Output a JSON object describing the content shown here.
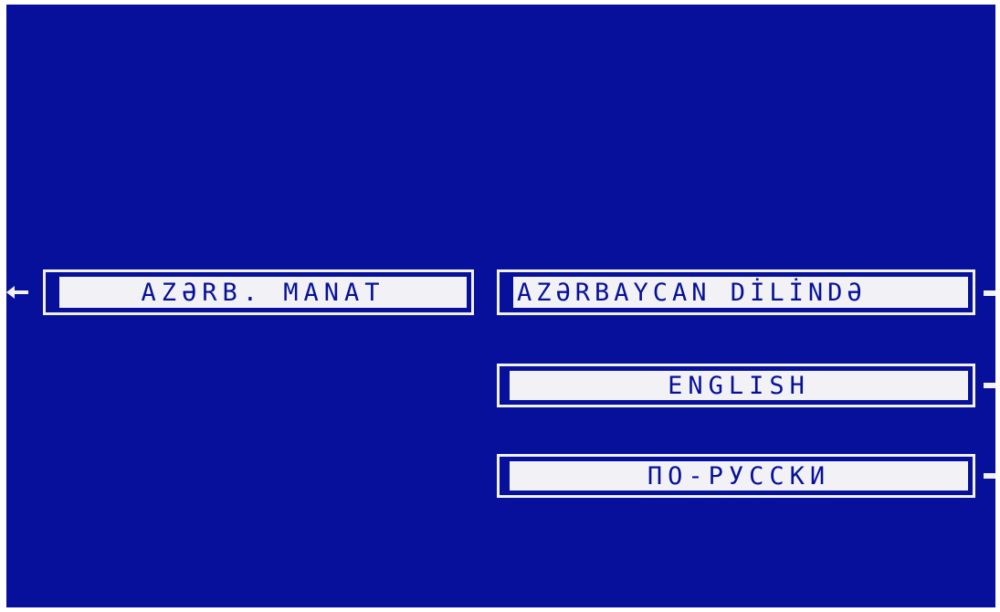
{
  "screen": {
    "background_color": "#06109a",
    "foreground_color": "#f2f2f6"
  },
  "left_options": [
    {
      "label": "AZƏRB. MANAT",
      "icon": "arrow-left-icon"
    }
  ],
  "right_options": [
    {
      "label": "AZƏRBAYCAN DİLİNDƏ"
    },
    {
      "label": "ENGLISH"
    },
    {
      "label": "ПО-РУССКИ"
    }
  ]
}
